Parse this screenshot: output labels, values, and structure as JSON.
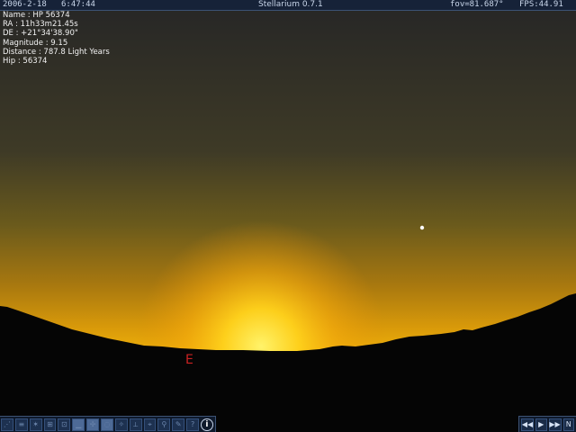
{
  "topbar": {
    "date": "2006-2-18",
    "time": "6:47:44",
    "title": "Stellarium 0.7.1",
    "fov": "fov=81.687°",
    "fps": "FPS:44.91"
  },
  "object_info": {
    "name": "Name : HP 56374",
    "ra": "RA : 11h33m21.45s",
    "de": "DE : +21°34'38.90\"",
    "magnitude": "Magnitude : 9.15",
    "distance": "Distance : 787.8 Light Years",
    "hip": "Hip : 56374"
  },
  "cardinal": {
    "east": "E"
  },
  "toolbar_left": {
    "buttons": [
      "constellation-lines-icon",
      "constellation-names-icon",
      "constellation-art-icon",
      "azimuth-grid-icon",
      "equatorial-grid-icon",
      "ground-icon",
      "cardinal-points-icon",
      "atmosphere-icon",
      "nebula-names-icon",
      "equatorial-mount-icon",
      "goto-icon",
      "search-icon",
      "config-icon",
      "night-mode-icon",
      "help-icon"
    ],
    "help_label": "?",
    "info_label": "i"
  },
  "toolbar_right": {
    "rewind": "◀◀",
    "play": "▶",
    "forward": "▶▶",
    "now": "N"
  },
  "colors": {
    "sky_top": "#2a2a2a",
    "sky_mid": "#5a5120",
    "sky_low": "#c98a14",
    "sun_glow": "#ffdd22",
    "ground": "#050505",
    "toolbar_bg": "#0f1a2c",
    "cardinal": "#cc2222"
  }
}
